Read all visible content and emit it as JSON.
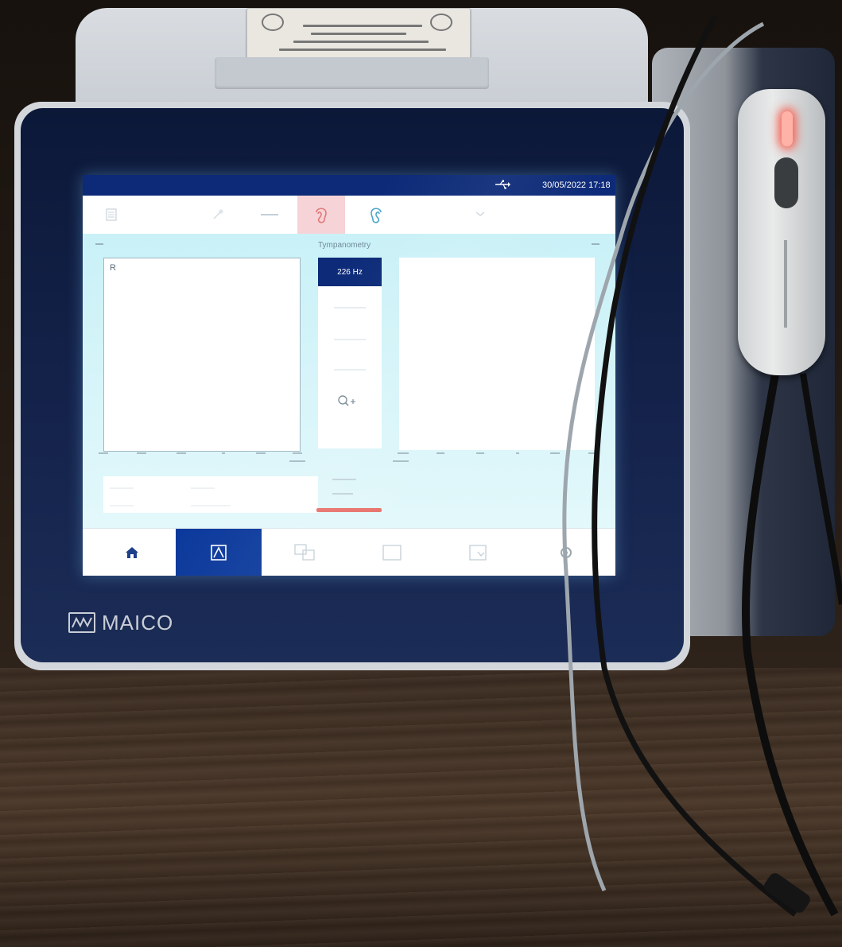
{
  "status_bar": {
    "datetime": "30/05/2022  17:18"
  },
  "toolbar": {
    "items": [
      {
        "name": "menu-icon"
      },
      {
        "name": "probe-icon"
      },
      {
        "name": "ear-right-icon",
        "active": true
      },
      {
        "name": "ear-left-icon"
      },
      {
        "name": "arrow-icon"
      }
    ]
  },
  "main": {
    "section_title": "Tympanometry",
    "left_plot": {
      "ear_label": "R"
    },
    "frequency_button": "226 Hz"
  },
  "bottom_nav": {
    "items": [
      {
        "name": "home-icon",
        "active": false
      },
      {
        "name": "tympanometry-icon",
        "active": true
      },
      {
        "name": "reflex-icon",
        "active": false
      },
      {
        "name": "blank-screen-icon",
        "active": false
      },
      {
        "name": "report-icon",
        "active": false
      },
      {
        "name": "settings-icon",
        "active": false
      }
    ]
  },
  "device": {
    "brand": "MAICO"
  },
  "colors": {
    "accent_dark_blue": "#0c2a78",
    "active_nav_blue": "#0c3a9c",
    "active_tab_pink": "#f6d3d6",
    "status_red": "#e8736e",
    "screen_cyan": "#c9f1f7"
  }
}
